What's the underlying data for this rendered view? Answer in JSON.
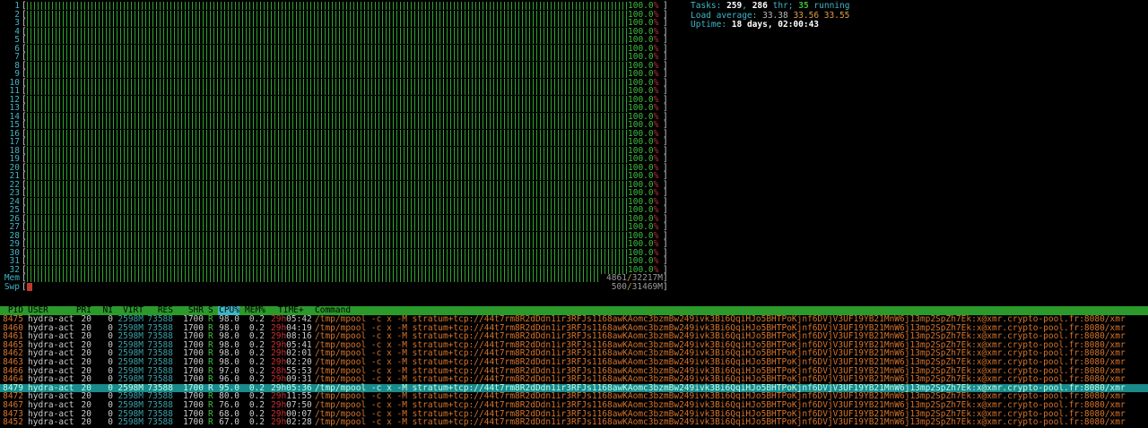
{
  "cpu_meters": [
    {
      "label": "1",
      "value": "100.0",
      "unit": "%"
    },
    {
      "label": "2",
      "value": "100.0",
      "unit": "%"
    },
    {
      "label": "3",
      "value": "100.0",
      "unit": "%"
    },
    {
      "label": "4",
      "value": "100.0",
      "unit": "%"
    },
    {
      "label": "5",
      "value": "100.0",
      "unit": "%"
    },
    {
      "label": "6",
      "value": "100.0",
      "unit": "%"
    },
    {
      "label": "7",
      "value": "100.0",
      "unit": "%"
    },
    {
      "label": "8",
      "value": "100.0",
      "unit": "%"
    },
    {
      "label": "9",
      "value": "100.0",
      "unit": "%"
    },
    {
      "label": "10",
      "value": "100.0",
      "unit": "%"
    },
    {
      "label": "11",
      "value": "100.0",
      "unit": "%"
    },
    {
      "label": "12",
      "value": "100.0",
      "unit": "%"
    },
    {
      "label": "13",
      "value": "100.0",
      "unit": "%"
    },
    {
      "label": "14",
      "value": "100.0",
      "unit": "%"
    },
    {
      "label": "15",
      "value": "100.0",
      "unit": "%"
    },
    {
      "label": "16",
      "value": "100.0",
      "unit": "%"
    },
    {
      "label": "17",
      "value": "100.0",
      "unit": "%"
    },
    {
      "label": "18",
      "value": "100.0",
      "unit": "%"
    },
    {
      "label": "19",
      "value": "100.0",
      "unit": "%"
    },
    {
      "label": "20",
      "value": "100.0",
      "unit": "%"
    },
    {
      "label": "21",
      "value": "100.0",
      "unit": "%"
    },
    {
      "label": "22",
      "value": "100.0",
      "unit": "%"
    },
    {
      "label": "23",
      "value": "100.0",
      "unit": "%"
    },
    {
      "label": "24",
      "value": "100.0",
      "unit": "%"
    },
    {
      "label": "25",
      "value": "100.0",
      "unit": "%"
    },
    {
      "label": "26",
      "value": "100.0",
      "unit": "%"
    },
    {
      "label": "27",
      "value": "100.0",
      "unit": "%"
    },
    {
      "label": "28",
      "value": "100.0",
      "unit": "%"
    },
    {
      "label": "29",
      "value": "100.0",
      "unit": "%"
    },
    {
      "label": "30",
      "value": "100.0",
      "unit": "%"
    },
    {
      "label": "31",
      "value": "100.0",
      "unit": "%"
    },
    {
      "label": "32",
      "value": "100.0",
      "unit": "%"
    }
  ],
  "mem": {
    "label": "Mem",
    "used": "4861",
    "sep": "/",
    "total": "32217M",
    "fraction": 0.151
  },
  "swap": {
    "label": "Swp",
    "used": "500",
    "sep": "/",
    "total": "31469M",
    "fraction": 0.016
  },
  "stats": {
    "tasks_label": "Tasks:",
    "tasks": "259",
    "thr_sep": ",",
    "thr": "286",
    "thr_label": "thr;",
    "running": "35",
    "running_label": "running",
    "load_label": "Load average:",
    "load1": "33.38",
    "load5": "33.56",
    "load15": "33.55",
    "uptime_label": "Uptime:",
    "uptime": "18 days, 02:00:43"
  },
  "columns": {
    "pid": "PID",
    "user": "USER",
    "pri": "PRI",
    "ni": "NI",
    "virt": "VIRT",
    "res": "RES",
    "shr": "SHR",
    "s": "S",
    "cpu": "CPU%",
    "mem": "MEM%",
    "time": "TIME+",
    "command": "Command"
  },
  "processes": [
    {
      "pid": "8475",
      "user": "hydra-act",
      "pri": "20",
      "ni": "0",
      "virt": "2598M",
      "res": "73588",
      "shr": "1700",
      "s": "R",
      "cpu": "98.0",
      "mem": "0.2",
      "time_h": "29h",
      "time_m": "05:42",
      "cmd": "/tmp/mpool -c x -M stratum+tcp://44t7rm8R2dDdn1ir3RFJs1168awKAomc3bzmBw249ivk3Bi6QqiHJo5BHTPoKjnf6DVjV3UF19YB21MnW6j13mp2SpZh7Ek:x@xmr.crypto-pool.fr:8080/xmr",
      "selected": false
    },
    {
      "pid": "8460",
      "user": "hydra-act",
      "pri": "20",
      "ni": "0",
      "virt": "2598M",
      "res": "73588",
      "shr": "1700",
      "s": "R",
      "cpu": "98.0",
      "mem": "0.2",
      "time_h": "29h",
      "time_m": "04:19",
      "cmd": "/tmp/mpool -c x -M stratum+tcp://44t7rm8R2dDdn1ir3RFJs1168awKAomc3bzmBw249ivk3Bi6QqiHJo5BHTPoKjnf6DVjV3UF19YB21MnW6j13mp2SpZh7Ek:x@xmr.crypto-pool.fr:8080/xmr",
      "selected": false
    },
    {
      "pid": "8461",
      "user": "hydra-act",
      "pri": "20",
      "ni": "0",
      "virt": "2598M",
      "res": "73588",
      "shr": "1700",
      "s": "R",
      "cpu": "98.0",
      "mem": "0.2",
      "time_h": "29h",
      "time_m": "08:16",
      "cmd": "/tmp/mpool -c x -M stratum+tcp://44t7rm8R2dDdn1ir3RFJs1168awKAomc3bzmBw249ivk3Bi6QqiHJo5BHTPoKjnf6DVjV3UF19YB21MnW6j13mp2SpZh7Ek:x@xmr.crypto-pool.fr:8080/xmr",
      "selected": false
    },
    {
      "pid": "8465",
      "user": "hydra-act",
      "pri": "20",
      "ni": "0",
      "virt": "2598M",
      "res": "73588",
      "shr": "1700",
      "s": "R",
      "cpu": "98.0",
      "mem": "0.2",
      "time_h": "29h",
      "time_m": "05:41",
      "cmd": "/tmp/mpool -c x -M stratum+tcp://44t7rm8R2dDdn1ir3RFJs1168awKAomc3bzmBw249ivk3Bi6QqiHJo5BHTPoKjnf6DVjV3UF19YB21MnW6j13mp2SpZh7Ek:x@xmr.crypto-pool.fr:8080/xmr",
      "selected": false
    },
    {
      "pid": "8462",
      "user": "hydra-act",
      "pri": "20",
      "ni": "0",
      "virt": "2598M",
      "res": "73588",
      "shr": "1700",
      "s": "R",
      "cpu": "98.0",
      "mem": "0.2",
      "time_h": "29h",
      "time_m": "02:01",
      "cmd": "/tmp/mpool -c x -M stratum+tcp://44t7rm8R2dDdn1ir3RFJs1168awKAomc3bzmBw249ivk3Bi6QqiHJo5BHTPoKjnf6DVjV3UF19YB21MnW6j13mp2SpZh7Ek:x@xmr.crypto-pool.fr:8080/xmr",
      "selected": false
    },
    {
      "pid": "8463",
      "user": "hydra-act",
      "pri": "20",
      "ni": "0",
      "virt": "2598M",
      "res": "73588",
      "shr": "1700",
      "s": "R",
      "cpu": "98.0",
      "mem": "0.2",
      "time_h": "29h",
      "time_m": "02:20",
      "cmd": "/tmp/mpool -c x -M stratum+tcp://44t7rm8R2dDdn1ir3RFJs1168awKAomc3bzmBw249ivk3Bi6QqiHJo5BHTPoKjnf6DVjV3UF19YB21MnW6j13mp2SpZh7Ek:x@xmr.crypto-pool.fr:8080/xmr",
      "selected": false
    },
    {
      "pid": "8466",
      "user": "hydra-act",
      "pri": "20",
      "ni": "0",
      "virt": "2598M",
      "res": "73588",
      "shr": "1700",
      "s": "R",
      "cpu": "97.0",
      "mem": "0.2",
      "time_h": "28h",
      "time_m": "55:53",
      "cmd": "/tmp/mpool -c x -M stratum+tcp://44t7rm8R2dDdn1ir3RFJs1168awKAomc3bzmBw249ivk3Bi6QqiHJo5BHTPoKjnf6DVjV3UF19YB21MnW6j13mp2SpZh7Ek:x@xmr.crypto-pool.fr:8080/xmr",
      "selected": false
    },
    {
      "pid": "8464",
      "user": "hydra-act",
      "pri": "20",
      "ni": "0",
      "virt": "2598M",
      "res": "73588",
      "shr": "1700",
      "s": "R",
      "cpu": "96.0",
      "mem": "0.2",
      "time_h": "29h",
      "time_m": "09:31",
      "cmd": "/tmp/mpool -c x -M stratum+tcp://44t7rm8R2dDdn1ir3RFJs1168awKAomc3bzmBw249ivk3Bi6QqiHJo5BHTPoKjnf6DVjV3UF19YB21MnW6j13mp2SpZh7Ek:x@xmr.crypto-pool.fr:8080/xmr",
      "selected": false
    },
    {
      "pid": "8479",
      "user": "hydra-act",
      "pri": "20",
      "ni": "0",
      "virt": "2598M",
      "res": "73588",
      "shr": "1700",
      "s": "R",
      "cpu": "95.0",
      "mem": "0.2",
      "time_h": "29h",
      "time_m": "05:36",
      "cmd": "/tmp/mpool -c x -M stratum+tcp://44t7rm8R2dDdn1ir3RFJs1168awKAomc3bzmBw249ivk3Bi6QqiHJo5BHTPoKjnf6DVjV3UF19YB21MnW6j13mp2SpZh7Ek:x@xmr.crypto-pool.fr:8080/xmr",
      "selected": true
    },
    {
      "pid": "8472",
      "user": "hydra-act",
      "pri": "20",
      "ni": "0",
      "virt": "2598M",
      "res": "73588",
      "shr": "1700",
      "s": "R",
      "cpu": "80.0",
      "mem": "0.2",
      "time_h": "29h",
      "time_m": "11:55",
      "cmd": "/tmp/mpool -c x -M stratum+tcp://44t7rm8R2dDdn1ir3RFJs1168awKAomc3bzmBw249ivk3Bi6QqiHJo5BHTPoKjnf6DVjV3UF19YB21MnW6j13mp2SpZh7Ek:x@xmr.crypto-pool.fr:8080/xmr",
      "selected": false
    },
    {
      "pid": "8467",
      "user": "hydra-act",
      "pri": "20",
      "ni": "0",
      "virt": "2598M",
      "res": "73588",
      "shr": "1700",
      "s": "R",
      "cpu": "76.0",
      "mem": "0.2",
      "time_h": "29h",
      "time_m": "07:50",
      "cmd": "/tmp/mpool -c x -M stratum+tcp://44t7rm8R2dDdn1ir3RFJs1168awKAomc3bzmBw249ivk3Bi6QqiHJo5BHTPoKjnf6DVjV3UF19YB21MnW6j13mp2SpZh7Ek:x@xmr.crypto-pool.fr:8080/xmr",
      "selected": false
    },
    {
      "pid": "8473",
      "user": "hydra-act",
      "pri": "20",
      "ni": "0",
      "virt": "2598M",
      "res": "73588",
      "shr": "1700",
      "s": "R",
      "cpu": "68.0",
      "mem": "0.2",
      "time_h": "29h",
      "time_m": "00:07",
      "cmd": "/tmp/mpool -c x -M stratum+tcp://44t7rm8R2dDdn1ir3RFJs1168awKAomc3bzmBw249ivk3Bi6QqiHJo5BHTPoKjnf6DVjV3UF19YB21MnW6j13mp2SpZh7Ek:x@xmr.crypto-pool.fr:8080/xmr",
      "selected": false
    },
    {
      "pid": "8452",
      "user": "hydra-act",
      "pri": "20",
      "ni": "0",
      "virt": "2598M",
      "res": "73588",
      "shr": "1700",
      "s": "R",
      "cpu": "67.0",
      "mem": "0.2",
      "time_h": "29h",
      "time_m": "02:28",
      "cmd": "/tmp/mpool -c x -M stratum+tcp://44t7rm8R2dDdn1ir3RFJs1168awKAomc3bzmBw249ivk3Bi6QqiHJo5BHTPoKjnf6DVjV3UF19YB21MnW6j13mp2SpZh7Ek:x@xmr.crypto-pool.fr:8080/xmr",
      "selected": false
    }
  ]
}
